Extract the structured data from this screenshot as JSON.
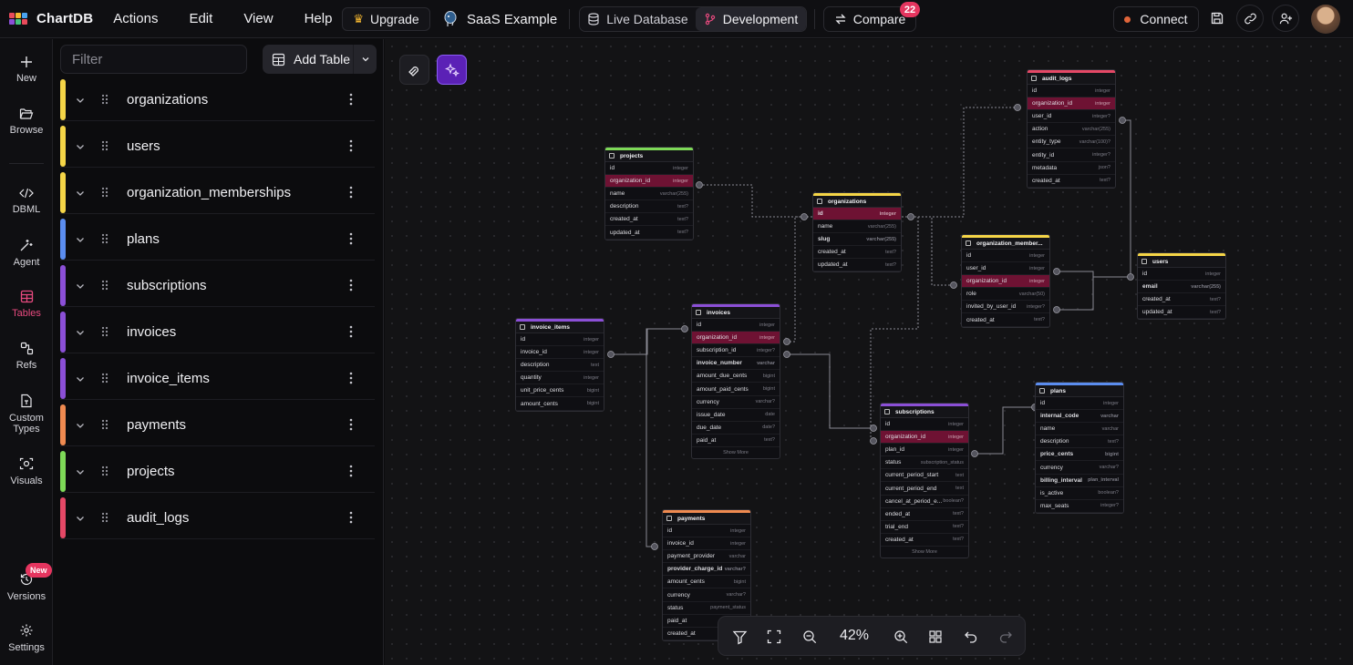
{
  "app": {
    "name": "ChartDB"
  },
  "menu": [
    "Actions",
    "Edit",
    "View",
    "Help"
  ],
  "topbar": {
    "upgrade_label": "Upgrade",
    "diagram_name": "SaaS Example",
    "env_live": "Live Database",
    "env_dev": "Development",
    "compare_label": "Compare",
    "compare_count": "22",
    "connect_label": "Connect"
  },
  "rail": {
    "new": "New",
    "browse": "Browse",
    "dbml": "DBML",
    "agent": "Agent",
    "tables": "Tables",
    "refs": "Refs",
    "custom_types": "Custom Types",
    "visuals": "Visuals",
    "versions": "Versions",
    "versions_badge": "New",
    "settings": "Settings"
  },
  "panel": {
    "filter_placeholder": "Filter",
    "add_table_label": "Add Table",
    "tables": [
      {
        "name": "organizations",
        "color": "#f5d547"
      },
      {
        "name": "users",
        "color": "#f5d547"
      },
      {
        "name": "organization_memberships",
        "color": "#f5d547"
      },
      {
        "name": "plans",
        "color": "#5b8def"
      },
      {
        "name": "subscriptions",
        "color": "#8b4fd6"
      },
      {
        "name": "invoices",
        "color": "#8b4fd6"
      },
      {
        "name": "invoice_items",
        "color": "#8b4fd6"
      },
      {
        "name": "payments",
        "color": "#ef8a50"
      },
      {
        "name": "projects",
        "color": "#7ed957"
      },
      {
        "name": "audit_logs",
        "color": "#e54866"
      }
    ]
  },
  "erd": {
    "show_more": "Show More",
    "tables": {
      "projects": {
        "title": "projects",
        "color": "#7ed957",
        "fields": [
          [
            "id",
            "integer"
          ],
          [
            "organization_id",
            "integer"
          ],
          [
            "name",
            "varchar(255)"
          ],
          [
            "description",
            "text?"
          ],
          [
            "created_at",
            "text?"
          ],
          [
            "updated_at",
            "text?"
          ]
        ]
      },
      "organizations": {
        "title": "organizations",
        "color": "#f5d547",
        "fields": [
          [
            "id",
            "integer"
          ],
          [
            "name",
            "varchar(255)"
          ],
          [
            "slug",
            "varchar(255)"
          ],
          [
            "created_at",
            "text?"
          ],
          [
            "updated_at",
            "text?"
          ]
        ]
      },
      "audit_logs": {
        "title": "audit_logs",
        "color": "#e54866",
        "fields": [
          [
            "id",
            "integer"
          ],
          [
            "organization_id",
            "integer"
          ],
          [
            "user_id",
            "integer?"
          ],
          [
            "action",
            "varchar(255)"
          ],
          [
            "entity_type",
            "varchar(100)?"
          ],
          [
            "entity_id",
            "integer?"
          ],
          [
            "metadata",
            "json?"
          ],
          [
            "created_at",
            "text?"
          ]
        ]
      },
      "organization_memberships": {
        "title": "organization_member...",
        "color": "#f5d547",
        "fields": [
          [
            "id",
            "integer"
          ],
          [
            "user_id",
            "integer"
          ],
          [
            "organization_id",
            "integer"
          ],
          [
            "role",
            "varchar(50)"
          ],
          [
            "invited_by_user_id",
            "integer?"
          ],
          [
            "created_at",
            "text?"
          ]
        ]
      },
      "users": {
        "title": "users",
        "color": "#f5d547",
        "fields": [
          [
            "id",
            "integer"
          ],
          [
            "email",
            "varchar(255)"
          ],
          [
            "created_at",
            "text?"
          ],
          [
            "updated_at",
            "text?"
          ]
        ]
      },
      "invoice_items": {
        "title": "invoice_items",
        "color": "#8b4fd6",
        "fields": [
          [
            "id",
            "integer"
          ],
          [
            "invoice_id",
            "integer"
          ],
          [
            "description",
            "text"
          ],
          [
            "quantity",
            "integer"
          ],
          [
            "unit_price_cents",
            "bigint"
          ],
          [
            "amount_cents",
            "bigint"
          ]
        ]
      },
      "invoices": {
        "title": "invoices",
        "color": "#8b4fd6",
        "fields": [
          [
            "id",
            "integer"
          ],
          [
            "organization_id",
            "integer"
          ],
          [
            "subscription_id",
            "integer?"
          ],
          [
            "invoice_number",
            "varchar"
          ],
          [
            "amount_due_cents",
            "bigint"
          ],
          [
            "amount_paid_cents",
            "bigint"
          ],
          [
            "currency",
            "varchar?"
          ],
          [
            "issue_date",
            "date"
          ],
          [
            "due_date",
            "date?"
          ],
          [
            "paid_at",
            "text?"
          ]
        ]
      },
      "subscriptions": {
        "title": "subscriptions",
        "color": "#8b4fd6",
        "fields": [
          [
            "id",
            "integer"
          ],
          [
            "organization_id",
            "integer"
          ],
          [
            "plan_id",
            "integer"
          ],
          [
            "status",
            "subscription_status"
          ],
          [
            "current_period_start",
            "text"
          ],
          [
            "current_period_end",
            "text"
          ],
          [
            "cancel_at_period_e...",
            "boolean?"
          ],
          [
            "ended_at",
            "text?"
          ],
          [
            "trial_end",
            "text?"
          ],
          [
            "created_at",
            "text?"
          ]
        ]
      },
      "plans": {
        "title": "plans",
        "color": "#5b8def",
        "fields": [
          [
            "id",
            "integer"
          ],
          [
            "internal_code",
            "varchar"
          ],
          [
            "name",
            "varchar"
          ],
          [
            "description",
            "text?"
          ],
          [
            "price_cents",
            "bigint"
          ],
          [
            "currency",
            "varchar?"
          ],
          [
            "billing_interval",
            "plan_interval"
          ],
          [
            "is_active",
            "boolean?"
          ],
          [
            "max_seats",
            "integer?"
          ]
        ]
      },
      "payments": {
        "title": "payments",
        "color": "#ef8a50",
        "fields": [
          [
            "id",
            "integer"
          ],
          [
            "invoice_id",
            "integer"
          ],
          [
            "payment_provider",
            "varchar"
          ],
          [
            "provider_charge_id",
            "varchar?"
          ],
          [
            "amount_cents",
            "bigint"
          ],
          [
            "currency",
            "varchar?"
          ],
          [
            "status",
            "payment_status"
          ],
          [
            "paid_at",
            ""
          ],
          [
            "created_at",
            ""
          ]
        ]
      }
    }
  },
  "toolbar": {
    "zoom": "42%"
  }
}
